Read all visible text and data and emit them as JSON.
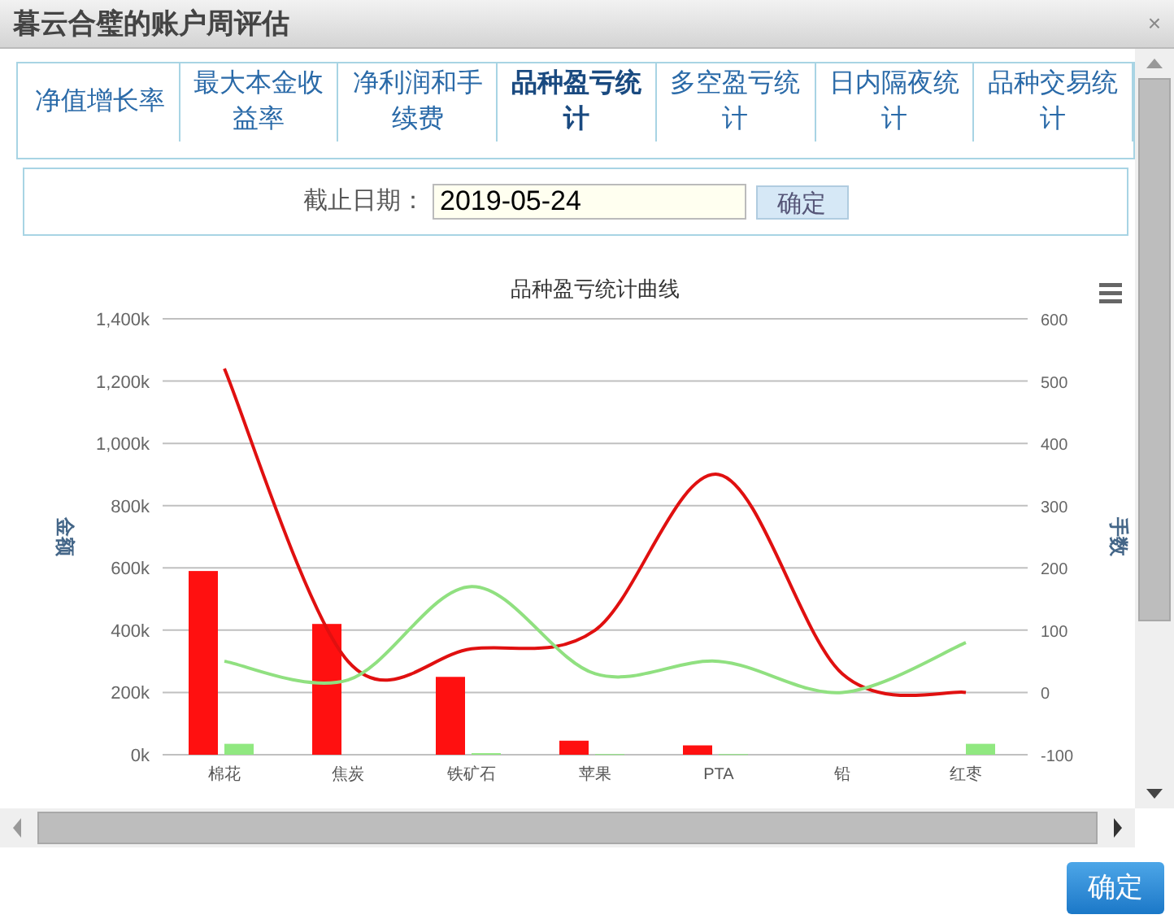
{
  "window": {
    "title": "暮云合璧的账户周评估",
    "close": "×"
  },
  "tabs": [
    {
      "label": "净值增长率",
      "selected": false
    },
    {
      "label": "最大本金收益率",
      "selected": false
    },
    {
      "label": "净利润和手续费",
      "selected": false
    },
    {
      "label": "品种盈亏统计",
      "selected": true
    },
    {
      "label": "多空盈亏统计",
      "selected": false
    },
    {
      "label": "日内隔夜统计",
      "selected": false
    },
    {
      "label": "品种交易统计",
      "selected": false
    }
  ],
  "date_form": {
    "label": "截止日期：",
    "value": "2019-05-24",
    "button": "确定"
  },
  "chart": {
    "chart_data": {
      "type": "bar",
      "title": "品种盈亏统计曲线",
      "ylabel": "金额",
      "y2label": "手数",
      "categories": [
        "棉花",
        "焦炭",
        "铁矿石",
        "苹果",
        "PTA",
        "铅",
        "红枣"
      ],
      "ylim": [
        0,
        1400000
      ],
      "yticks": [
        {
          "value": 0,
          "label": "0k"
        },
        {
          "value": 200000,
          "label": "200k"
        },
        {
          "value": 400000,
          "label": "400k"
        },
        {
          "value": 600000,
          "label": "600k"
        },
        {
          "value": 800000,
          "label": "800k"
        },
        {
          "value": 1000000,
          "label": "1,000k"
        },
        {
          "value": 1200000,
          "label": "1,200k"
        },
        {
          "value": 1400000,
          "label": "1,400k"
        }
      ],
      "y2lim": [
        -100,
        600
      ],
      "y2ticks": [
        -100,
        0,
        100,
        200,
        300,
        400,
        500,
        600
      ],
      "series": [
        {
          "type": "bar",
          "color": "#ff1010",
          "values": [
            590000,
            420000,
            250000,
            45000,
            30000,
            0,
            0
          ]
        },
        {
          "type": "bar",
          "color": "#90e880",
          "values": [
            35000,
            0,
            5000,
            2000,
            2000,
            0,
            35000
          ]
        },
        {
          "type": "line",
          "axis": "y2",
          "color": "#e01010",
          "values": [
            520,
            50,
            70,
            100,
            350,
            30,
            0
          ]
        },
        {
          "type": "line",
          "axis": "y2",
          "color": "#90e080",
          "values": [
            50,
            20,
            170,
            30,
            50,
            0,
            80
          ]
        }
      ],
      "stacked": false,
      "grid": true
    }
  },
  "footer": {
    "button": "确定"
  }
}
